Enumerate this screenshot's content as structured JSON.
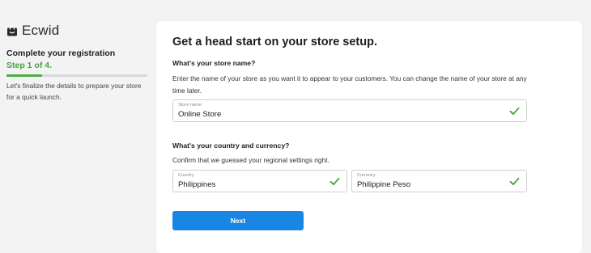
{
  "brand": {
    "name": "Ecwid"
  },
  "sidebar": {
    "title": "Complete your registration",
    "step": "Step 1 of 4.",
    "progress_fraction": 0.25,
    "description": "Let's finalize the details to prepare your store for a quick launch."
  },
  "main": {
    "title": "Get a head start on your store setup.",
    "store_section": {
      "question": "What's your store name?",
      "description": "Enter the name of your store as you want it to appear to your customers. You can change the name of your store at any time later.",
      "store_name_label": "Store name",
      "store_name_value": "Online Store"
    },
    "region_section": {
      "question": "What's your country and currency?",
      "description": "Confirm that we guessed your regional settings right.",
      "country_label": "Country",
      "country_value": "Philippines",
      "currency_label": "Currency",
      "currency_value": "Philippine Peso"
    },
    "next_label": "Next"
  },
  "colors": {
    "accent_green": "#45a33b",
    "button_blue": "#1a86e3"
  },
  "icons": {
    "logo": "shopping-bag-icon",
    "valid": "check-icon"
  }
}
